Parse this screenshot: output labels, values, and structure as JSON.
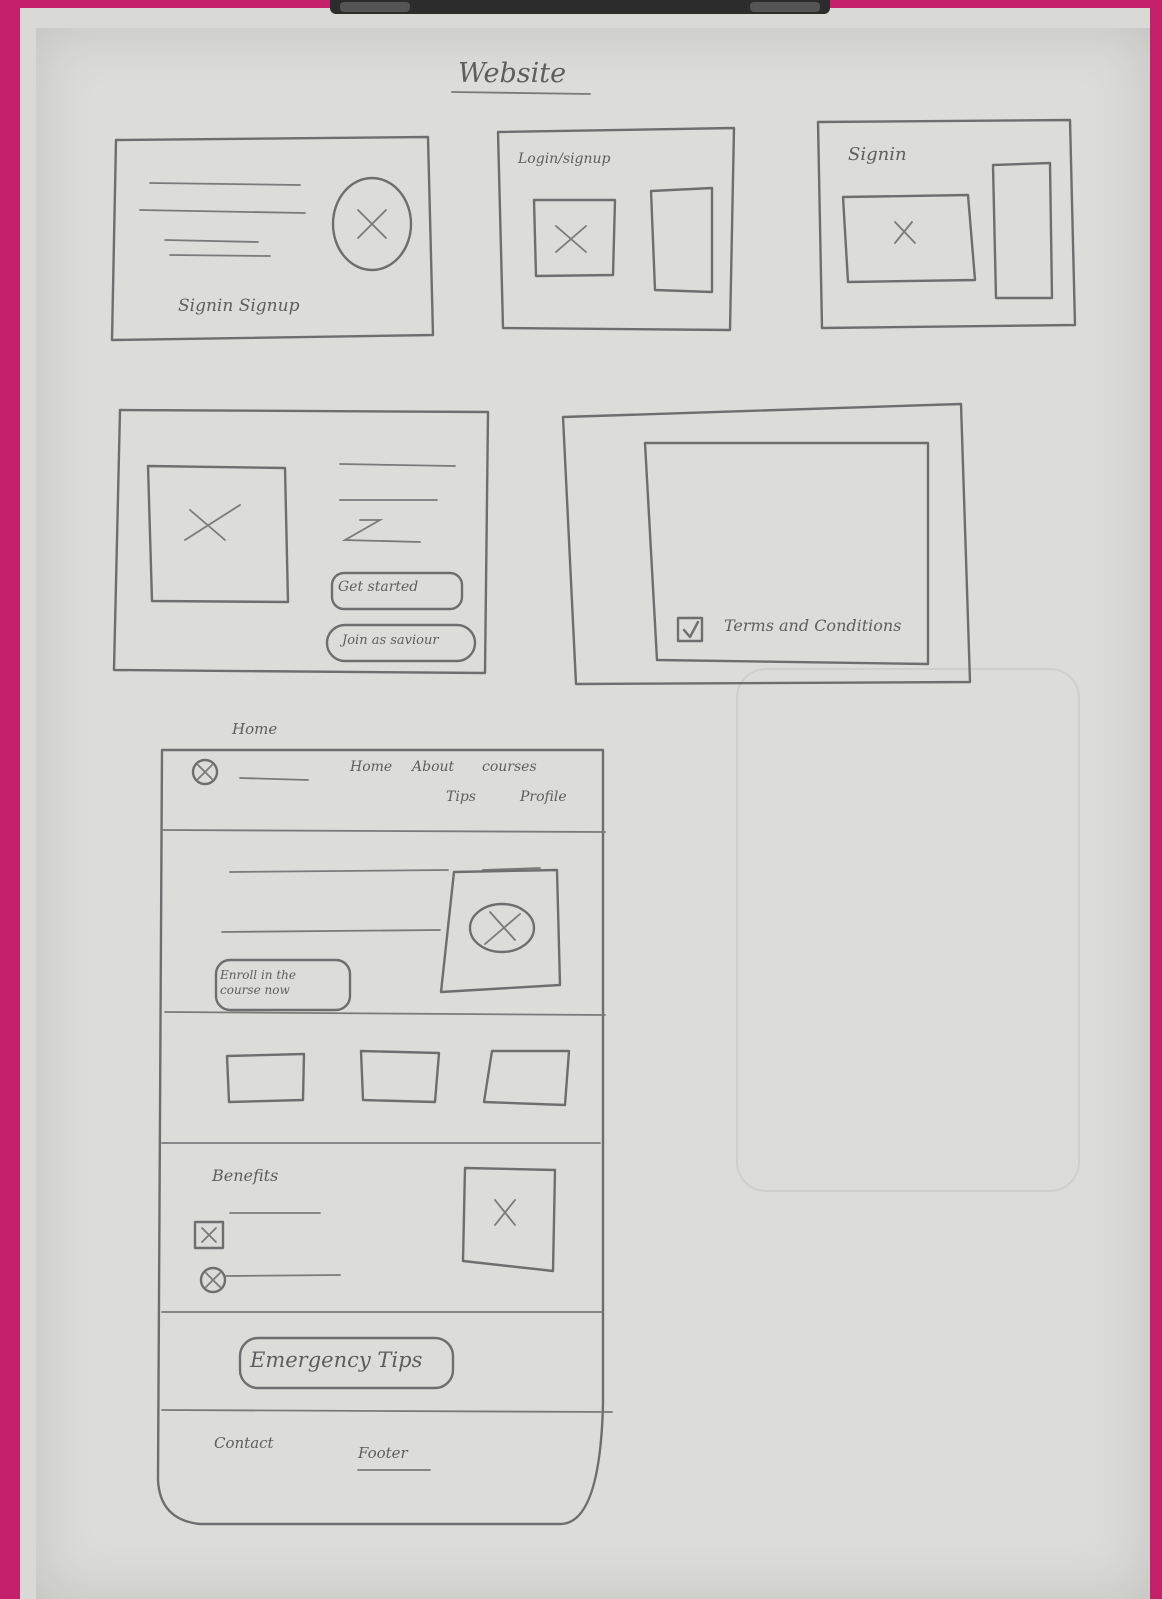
{
  "page_title": "Website",
  "frames": {
    "splash": {
      "label": "Signin Signup"
    },
    "login": {
      "title": "Login/signup"
    },
    "signin": {
      "title": "Signin"
    },
    "landing": {
      "primary_button": "Get started",
      "secondary_button": "Join as saviour"
    },
    "terms": {
      "checkbox_label": "Terms and Conditions"
    }
  },
  "home": {
    "frame_label": "Home",
    "nav": [
      "Home",
      "About",
      "courses",
      "Tips",
      "Profile"
    ],
    "hero_button": "Enroll in the course now",
    "benefits_title": "Benefits",
    "emergency_button": "Emergency Tips",
    "footer_contact": "Contact",
    "footer_label": "Footer"
  },
  "colors": {
    "paper": "#dcdcd9",
    "pencil": "#6e6e6e",
    "background": "#c41f6a"
  }
}
